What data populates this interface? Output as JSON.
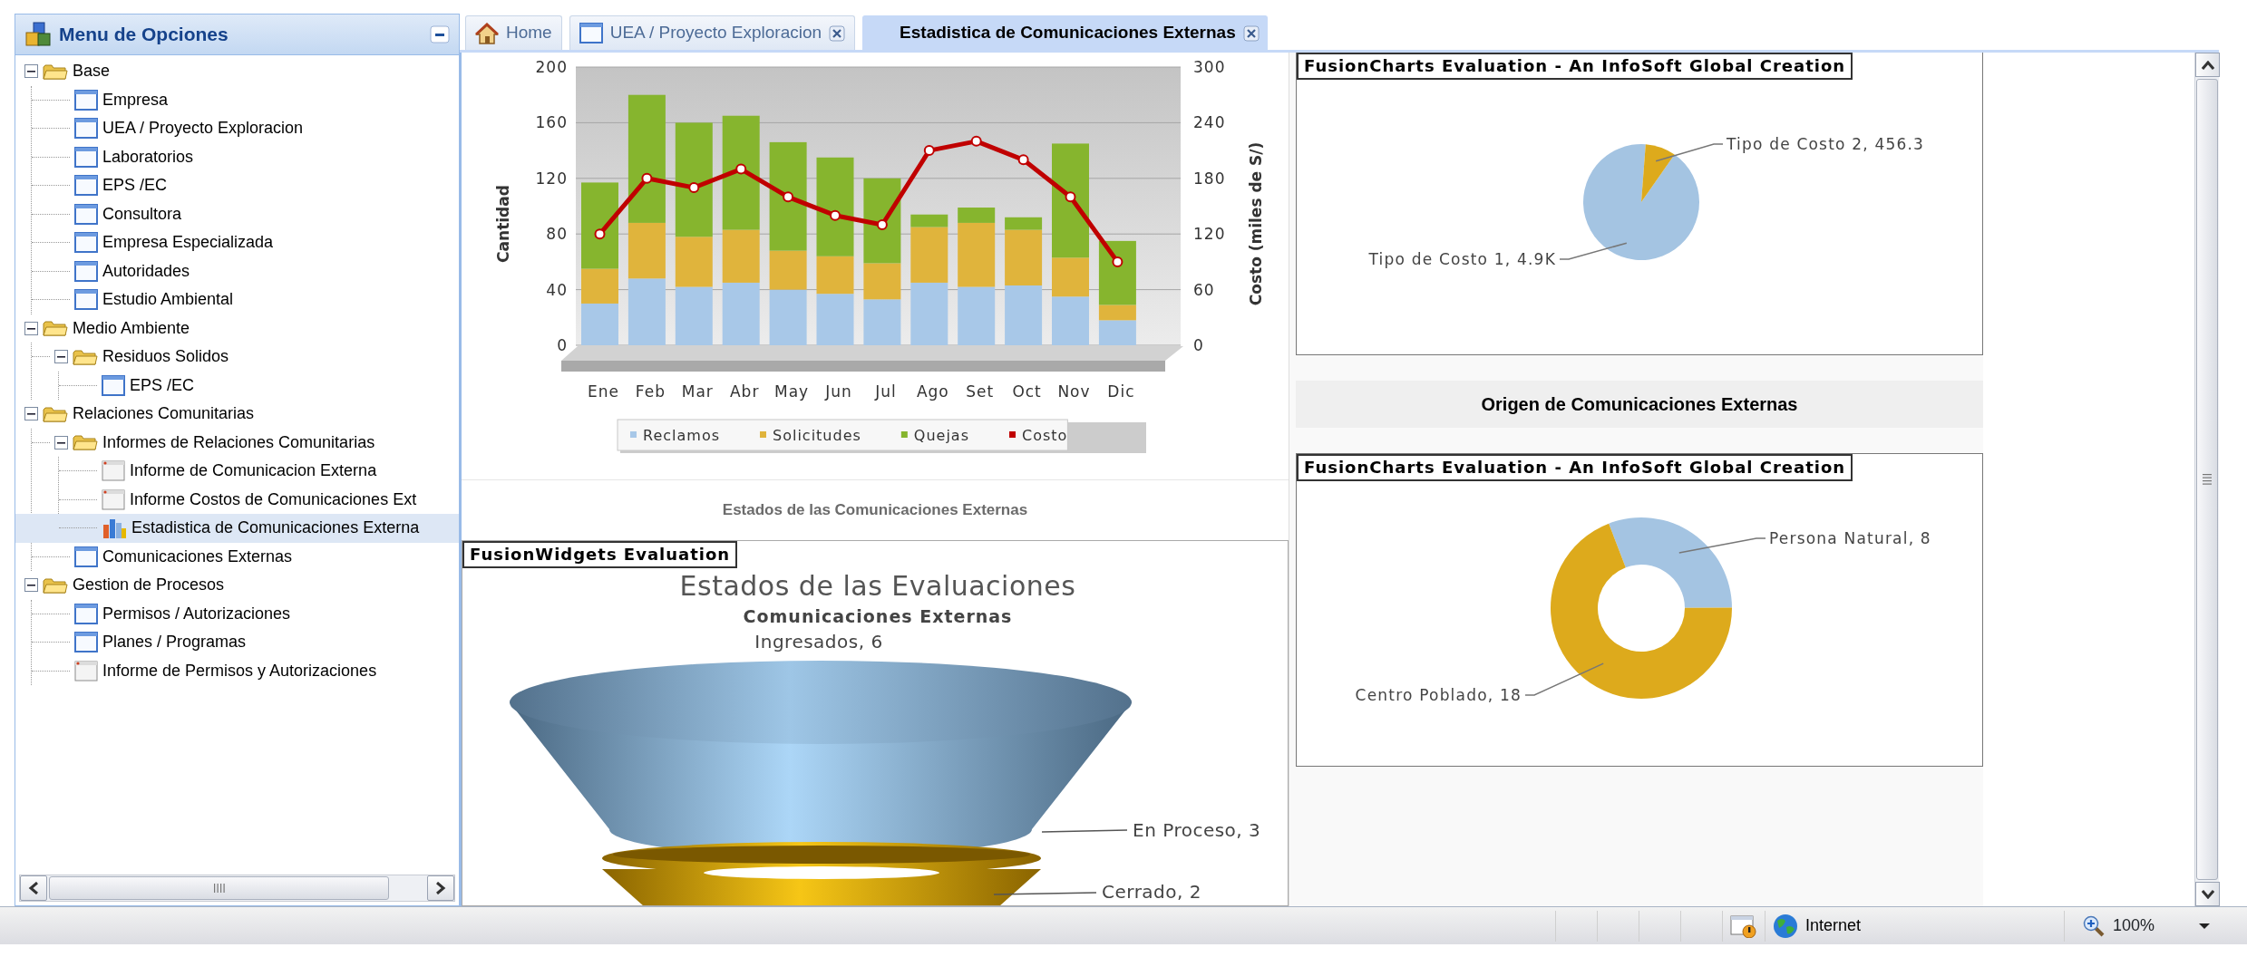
{
  "sidebar": {
    "title": "Menu de Opciones",
    "tree": [
      {
        "label": "Base",
        "kind": "folder",
        "expanded": true,
        "selected": false,
        "children": [
          {
            "label": "Empresa",
            "kind": "page",
            "selected": false
          },
          {
            "label": "UEA / Proyecto Exploracion",
            "kind": "page",
            "selected": false
          },
          {
            "label": "Laboratorios",
            "kind": "page",
            "selected": false
          },
          {
            "label": "EPS /EC",
            "kind": "page",
            "selected": false
          },
          {
            "label": "Consultora",
            "kind": "page",
            "selected": false
          },
          {
            "label": "Empresa Especializada",
            "kind": "page",
            "selected": false
          },
          {
            "label": "Autoridades",
            "kind": "page",
            "selected": false
          },
          {
            "label": "Estudio Ambiental",
            "kind": "page",
            "selected": false
          }
        ]
      },
      {
        "label": "Medio Ambiente",
        "kind": "folder",
        "expanded": true,
        "selected": false,
        "children": [
          {
            "label": "Residuos Solidos",
            "kind": "folder",
            "expanded": true,
            "selected": false,
            "children": [
              {
                "label": "EPS /EC",
                "kind": "page",
                "selected": false
              }
            ]
          }
        ]
      },
      {
        "label": "Relaciones Comunitarias",
        "kind": "folder",
        "expanded": true,
        "selected": false,
        "children": [
          {
            "label": "Informes de Relaciones Comunitarias",
            "kind": "folder",
            "expanded": true,
            "selected": false,
            "children": [
              {
                "label": "Informe de Comunicacion Externa",
                "kind": "form",
                "selected": false
              },
              {
                "label": "Informe Costos de Comunicaciones Ext",
                "kind": "form",
                "selected": false
              },
              {
                "label": "Estadistica de Comunicaciones Externa",
                "kind": "chart",
                "selected": true
              }
            ]
          },
          {
            "label": "Comunicaciones Externas",
            "kind": "page",
            "selected": false
          }
        ]
      },
      {
        "label": "Gestion de Procesos",
        "kind": "folder",
        "expanded": true,
        "selected": false,
        "children": [
          {
            "label": "Permisos / Autorizaciones",
            "kind": "page",
            "selected": false
          },
          {
            "label": "Planes / Programas",
            "kind": "page",
            "selected": false
          },
          {
            "label": "Informe de Permisos y Autorizaciones",
            "kind": "form",
            "selected": false
          }
        ]
      }
    ]
  },
  "tabs": [
    {
      "label": "Home",
      "kind": "home",
      "closable": false,
      "selected": false
    },
    {
      "label": "UEA / Proyecto Exploracion",
      "kind": "page",
      "closable": true,
      "selected": false
    },
    {
      "label": "Estadistica de Comunicaciones Externas",
      "kind": "plain",
      "closable": true,
      "selected": true
    }
  ],
  "monthly_panel": {
    "chart_data": {
      "type": "bar",
      "stacked": true,
      "grid": true,
      "legend": "bottom",
      "ylabel": "Cantidad",
      "ylim": [
        0,
        200
      ],
      "yticks": [
        0,
        40,
        80,
        120,
        160,
        200
      ],
      "categories": [
        "Ene",
        "Feb",
        "Mar",
        "Abr",
        "May",
        "Jun",
        "Jul",
        "Ago",
        "Set",
        "Oct",
        "Nov",
        "Dic"
      ],
      "series": [
        {
          "name": "Reclamos",
          "color": "#a8c8e8",
          "values": [
            30,
            48,
            42,
            45,
            40,
            37,
            33,
            45,
            42,
            43,
            35,
            18
          ]
        },
        {
          "name": "Solicitudes",
          "color": "#e0b43c",
          "values": [
            25,
            40,
            36,
            38,
            28,
            27,
            26,
            40,
            46,
            40,
            28,
            11
          ]
        },
        {
          "name": "Quejas",
          "color": "#86b52e",
          "values": [
            62,
            92,
            82,
            82,
            78,
            71,
            61,
            9,
            11,
            9,
            82,
            46
          ]
        }
      ]
    },
    "cost_line": {
      "chart_data": {
        "type": "line",
        "ylabel": "Costo (miles de S/)",
        "ylim": [
          0,
          300
        ],
        "yticks": [
          0,
          60,
          120,
          180,
          240,
          300
        ],
        "series": [
          {
            "name": "Costo",
            "color": "#c00000",
            "marker": "circle",
            "values": [
              120,
              180,
              170,
              190,
              160,
              140,
              130,
              210,
              220,
              200,
              160,
              90
            ]
          }
        ]
      }
    }
  },
  "status_panel": {
    "heading": "Estados de las Comunicaciones Externas",
    "notice": "FusionWidgets Evaluation",
    "title": "Estados de las Evaluaciones",
    "subtitle": "Comunicaciones Externas",
    "stages": [
      {
        "label": "Ingresados, 6"
      },
      {
        "label": "En Proceso, 3"
      },
      {
        "label": "Cerrado, 2"
      }
    ]
  },
  "cost_panel": {
    "notice": "FusionCharts Evaluation - An InfoSoft Global Creation",
    "chart_data": {
      "type": "pie",
      "values": [
        4900,
        456.3
      ],
      "value_labels": [
        "Tipo de Costo 1, 4.9K",
        "Tipo de Costo 2, 456.3"
      ]
    }
  },
  "origin_panel": {
    "heading": "Origen de Comunicaciones Externas",
    "notice": "FusionCharts Evaluation - An InfoSoft Global Creation",
    "chart_data": {
      "type": "donut",
      "values": [
        8,
        18
      ],
      "value_labels": [
        "Persona Natural, 8",
        "Centro Poblado, 18"
      ]
    }
  },
  "status_bar": {
    "zone": "Internet",
    "zoom": "100%"
  }
}
